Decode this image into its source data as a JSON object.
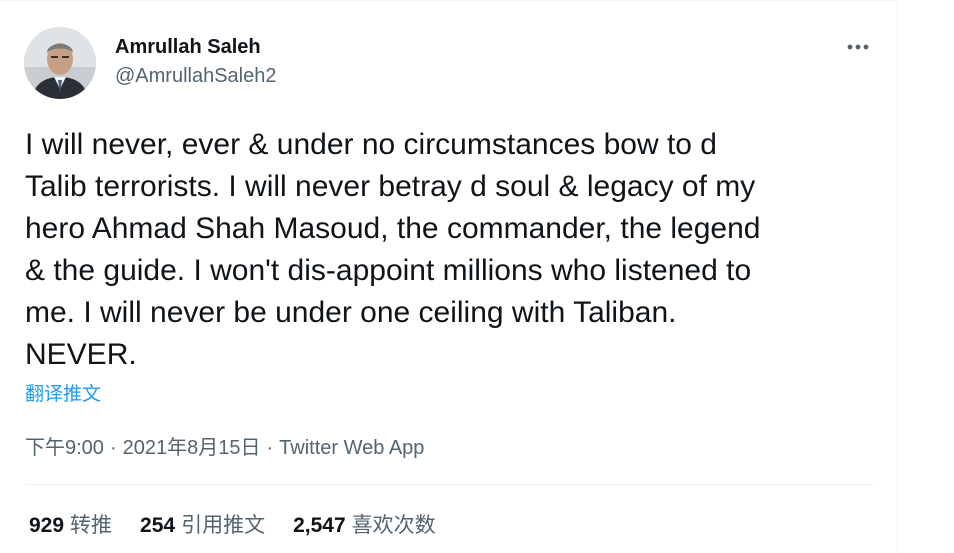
{
  "author": {
    "display_name": "Amrullah Saleh",
    "handle": "@AmrullahSaleh2",
    "avatar_icon": "user-avatar-photo"
  },
  "more_icon": "more-horizontal-icon",
  "tweet": {
    "lines": [
      "I will never, ever &  under no circumstances bow to d",
      "Talib terrorists. I will never betray d soul & legacy of my",
      "hero Ahmad Shah Masoud, the commander, the legend",
      "& the guide. I won't dis-appoint millions who listened to",
      "me. I will never be under one ceiling with Taliban.",
      "NEVER."
    ],
    "translate_label": "翻译推文",
    "time": "下午9:00",
    "date": "2021年8月15日",
    "separator": "·",
    "source": "Twitter Web App"
  },
  "stats": [
    {
      "count": "929",
      "label": "转推"
    },
    {
      "count": "254",
      "label": "引用推文"
    },
    {
      "count": "2,547",
      "label": "喜欢次数"
    }
  ],
  "colors": {
    "text_primary": "#0f1419",
    "text_secondary": "#536471",
    "link": "#1d9bf0",
    "border": "#eff3f4"
  }
}
